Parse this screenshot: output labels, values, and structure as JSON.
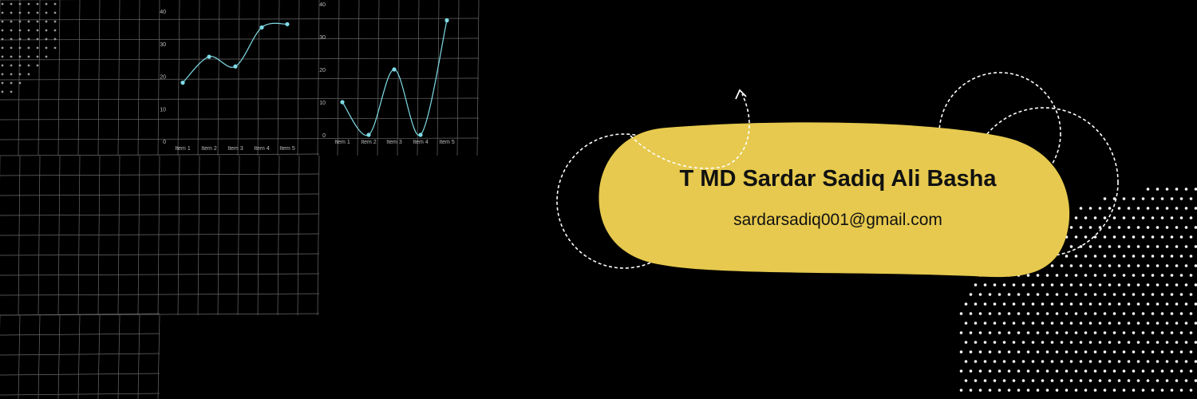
{
  "profile": {
    "name": "T MD Sardar Sadiq Ali Basha",
    "email": "sardarsadiq001@gmail.com"
  },
  "colors": {
    "background": "#000000",
    "card": "#e6c94e",
    "line": "#7fdce6",
    "grid": "#6a6a6a",
    "dots": "#ffffff"
  },
  "chart_data": [
    {
      "type": "line",
      "categories": [
        "Item 1",
        "Item 2",
        "Item 3",
        "Item 4",
        "Item 5"
      ],
      "series": [
        {
          "values": [
            18,
            26,
            23,
            35,
            36
          ]
        }
      ],
      "yticks": [
        0,
        10,
        20,
        30,
        40
      ],
      "ylim": [
        0,
        40
      ],
      "grid": true
    },
    {
      "type": "line",
      "categories": [
        "Item 1",
        "Item 2",
        "Item 3",
        "Item 4",
        "Item 5"
      ],
      "series": [
        {
          "values": [
            10,
            0,
            20,
            0,
            35
          ]
        }
      ],
      "yticks": [
        0,
        10,
        20,
        30,
        40
      ],
      "ylim": [
        0,
        40
      ],
      "grid": true
    }
  ]
}
